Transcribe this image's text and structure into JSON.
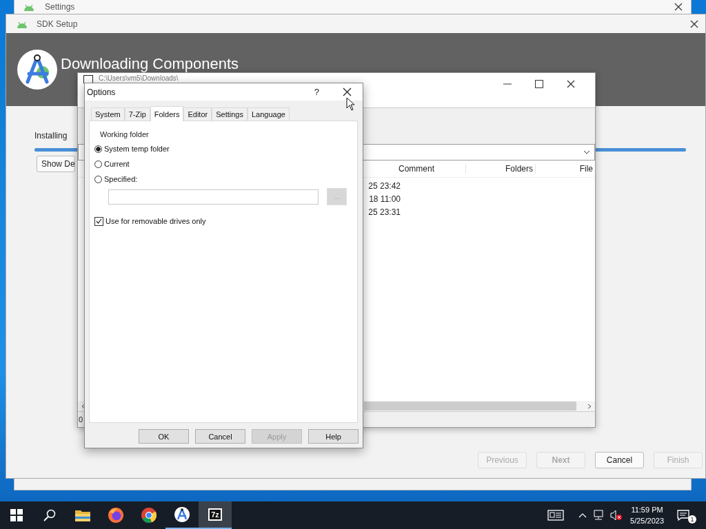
{
  "background_window": {
    "title": "Settings"
  },
  "sdk_setup": {
    "title": "SDK Setup",
    "heading": "Downloading Components",
    "status": "Installing",
    "progress": {
      "level": 1
    },
    "details_button": "Show De",
    "buttons": [
      {
        "label": "Previous",
        "disabled": true,
        "default": false
      },
      {
        "label": "Next",
        "disabled": true,
        "default": true
      },
      {
        "label": "Cancel",
        "disabled": false,
        "default": false
      },
      {
        "label": "Finish",
        "disabled": true,
        "default": false
      }
    ]
  },
  "file_manager": {
    "title": "C:\\Users\\vm5\\Downloads\\",
    "columns": [
      "Comment",
      "Folders",
      "File"
    ],
    "rows": [
      {
        "modified": "25 23:42"
      },
      {
        "modified": "18 11:00"
      },
      {
        "modified": "25 23:31"
      }
    ],
    "status_bar": "0"
  },
  "options_dialog": {
    "title": "Options",
    "help": "?",
    "tabs": [
      {
        "label": "System",
        "selected": false
      },
      {
        "label": "7-Zip",
        "selected": false
      },
      {
        "label": "Folders",
        "selected": true
      },
      {
        "label": "Editor",
        "selected": false
      },
      {
        "label": "Settings",
        "selected": false
      },
      {
        "label": "Language",
        "selected": false
      }
    ],
    "group_label": "Working folder",
    "radios": [
      {
        "label": "System temp folder",
        "selected": true
      },
      {
        "label": "Current",
        "selected": false
      },
      {
        "label": "Specified:",
        "selected": false
      }
    ],
    "browse_button": {
      "label": "...",
      "disabled": true
    },
    "checkbox": {
      "label": "Use for removable drives only",
      "checked": true
    },
    "buttons": [
      {
        "label": "OK",
        "disabled": false
      },
      {
        "label": "Cancel",
        "disabled": false
      },
      {
        "label": "Apply",
        "disabled": true
      },
      {
        "label": "Help",
        "disabled": false
      }
    ]
  },
  "taskbar": {
    "apps": [
      {
        "kind": "start",
        "running": false,
        "selected": false
      },
      {
        "kind": "search",
        "running": false,
        "selected": false
      },
      {
        "kind": "explorer",
        "running": false,
        "selected": false
      },
      {
        "kind": "firefox",
        "running": false,
        "selected": false
      },
      {
        "kind": "chrome",
        "running": false,
        "selected": false
      },
      {
        "kind": "studio",
        "running": true,
        "selected": false
      },
      {
        "kind": "sevenzip",
        "label": "7z",
        "running": true,
        "selected": true
      }
    ],
    "time": "11:59 PM",
    "date": "5/25/2023",
    "notifications": "1"
  }
}
